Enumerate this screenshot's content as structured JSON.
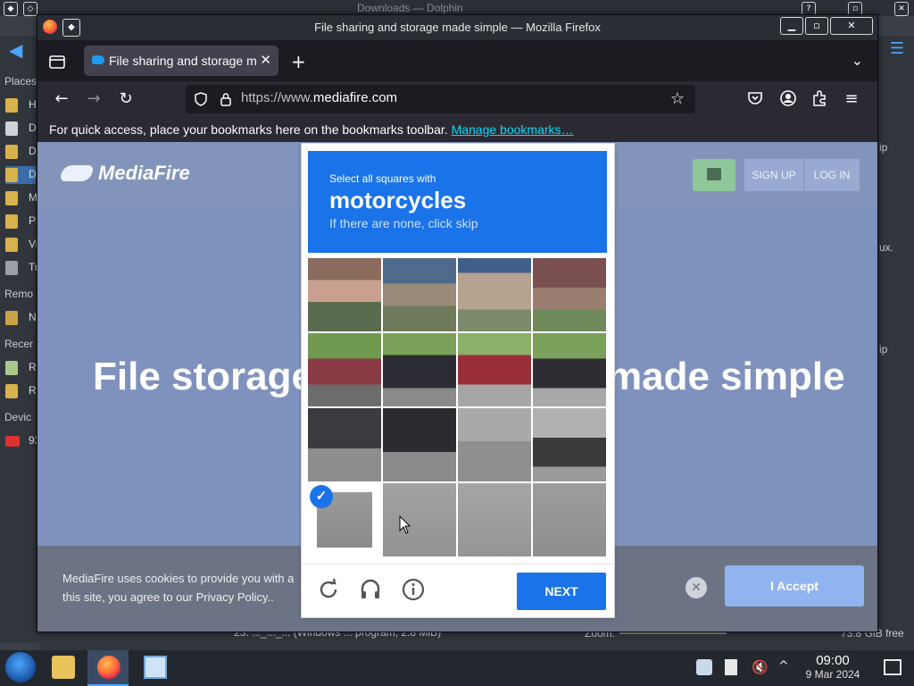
{
  "desktop": {
    "dolphin_title": "Downloads — Dolphin",
    "places_label": "Places",
    "places_items": [
      "Ho",
      "De",
      "Do",
      "Do",
      "M",
      "Pi",
      "Vi",
      "Tr"
    ],
    "remote_label": "Remo",
    "remote_items": [
      "Ne"
    ],
    "recent_label": "Recer",
    "recent_items": [
      "Re",
      "Re"
    ],
    "devices_label": "Devic",
    "devices_items": [
      "93"
    ],
    "right_texts": [
      "ip",
      "ux.",
      "ip"
    ],
    "status_file": "23. ..._..._...  (Windows ... program, 2.8 MiB)",
    "status_zoom": "Zoom:",
    "status_free": "73.8 GiB free"
  },
  "firefox": {
    "window_title": "File sharing and storage made simple — Mozilla Firefox",
    "tab_title": "File sharing and storage made simple",
    "url_prefix": "https://www.",
    "url_domain": "mediafire.com",
    "bookmarks_text": "For quick access, place your bookmarks here on the bookmarks toolbar.",
    "bookmarks_link": "Manage bookmarks…"
  },
  "mediafire": {
    "logo_text": "MediaFire",
    "signup_label": "SIGN UP",
    "login_label": "LOG IN",
    "hero_left": "File storage",
    "hero_right": "made simple",
    "cookie_line1": "MediaFire uses cookies to provide you with a",
    "cookie_line2": "this site, you agree to our Privacy Policy..",
    "accept_label": "I Accept"
  },
  "captcha": {
    "instruction_line1": "Select all squares with",
    "instruction_target": "motorcycles",
    "instruction_line3": "If there are none, click skip",
    "next_label": "NEXT",
    "selected_cells": [
      12
    ],
    "colors": {
      "accent": "#1a73e8"
    }
  },
  "taskbar": {
    "time": "09:00",
    "date": "9 Mar 2024"
  }
}
